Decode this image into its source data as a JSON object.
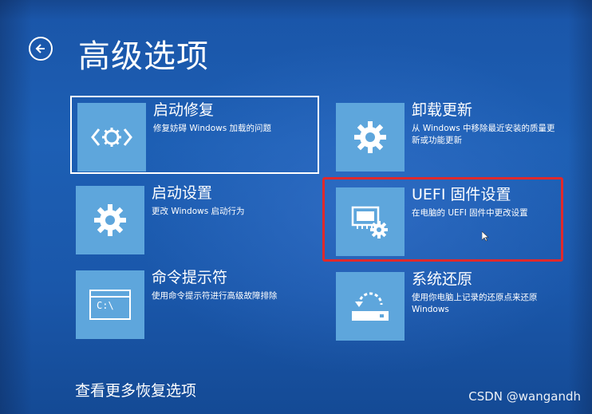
{
  "header": {
    "title": "高级选项"
  },
  "options": [
    {
      "title": "启动修复",
      "desc": "修复妨碍 Windows 加载的问题",
      "icon": "startup-repair-icon"
    },
    {
      "title": "卸载更新",
      "desc": "从 Windows 中移除最近安装的质量更新或功能更新",
      "icon": "gear-icon"
    },
    {
      "title": "启动设置",
      "desc": "更改 Windows 启动行为",
      "icon": "gear-icon"
    },
    {
      "title": "UEFI 固件设置",
      "desc": "在电脑的 UEFI 固件中更改设置",
      "icon": "firmware-chip-icon"
    },
    {
      "title": "命令提示符",
      "desc": "使用命令提示符进行高级故障排除",
      "icon": "command-prompt-icon",
      "icon_text": "C:\\"
    },
    {
      "title": "系统还原",
      "desc": "使用你电脑上记录的还原点来还原 Windows",
      "icon": "system-restore-icon"
    }
  ],
  "footer": {
    "more_options": "查看更多恢复选项"
  },
  "watermark": "CSDN @wangandh",
  "colors": {
    "background": "#1d5fb4",
    "tile": "#5ea6dc",
    "highlight": "#e0292b",
    "text": "#ffffff"
  }
}
